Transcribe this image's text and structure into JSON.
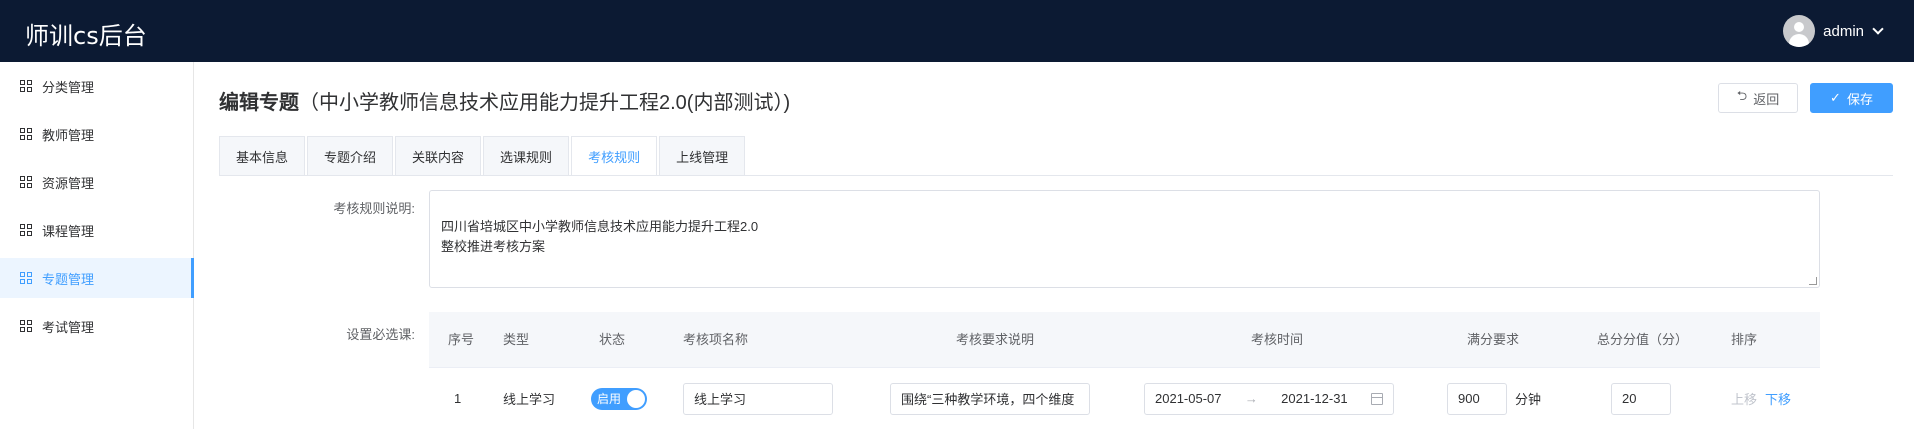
{
  "app": {
    "title": "师训cs后台"
  },
  "user": {
    "name": "admin"
  },
  "sidebar": {
    "items": [
      {
        "label": "分类管理",
        "icon": "grid-icon"
      },
      {
        "label": "教师管理",
        "icon": "grid-icon"
      },
      {
        "label": "资源管理",
        "icon": "grid-icon"
      },
      {
        "label": "课程管理",
        "icon": "grid-icon"
      },
      {
        "label": "专题管理",
        "icon": "grid-icon",
        "active": true
      },
      {
        "label": "考试管理",
        "icon": "grid-icon"
      }
    ]
  },
  "page": {
    "title_bold": "编辑专题",
    "title_sub": "（中小学教师信息技术应用能力提升工程2.0(内部测试）)",
    "back_label": "返回",
    "save_label": "保存"
  },
  "tabs": [
    "基本信息",
    "专题介绍",
    "关联内容",
    "选课规则",
    "考核规则",
    "上线管理"
  ],
  "active_tab": "考核规则",
  "form": {
    "desc_label": "考核规则说明:",
    "desc_value": "四川省培城区中小学教师信息技术应用能力提升工程2.0\n整校推进考核方案",
    "required_label": "设置必选课:"
  },
  "table": {
    "headers": [
      "序号",
      "类型",
      "状态",
      "考核项名称",
      "考核要求说明",
      "考核时间",
      "满分要求",
      "总分分值（分）",
      "排序"
    ],
    "rows": [
      {
        "index": "1",
        "type": "线上学习",
        "status": "启用",
        "name": "线上学习",
        "requirement": "围绕“三种教学环境，四个维度",
        "start_date": "2021-05-07",
        "range_sep": "→",
        "end_date": "2021-12-31",
        "full_score": "900",
        "unit": "分钟",
        "total_score": "20",
        "move_up": "上移",
        "move_down": "下移"
      }
    ]
  },
  "colors": {
    "topbar": "#0c1a33",
    "accent": "#409eff"
  }
}
